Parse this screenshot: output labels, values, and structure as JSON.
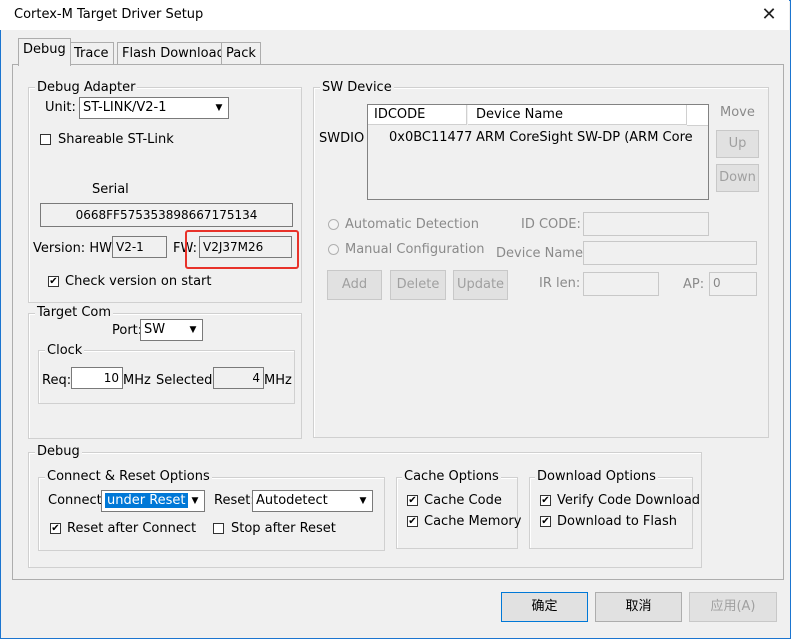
{
  "window": {
    "title": "Cortex-M Target Driver Setup",
    "close_label": "✕"
  },
  "tabs": [
    "Debug",
    "Trace",
    "Flash Download",
    "Pack"
  ],
  "debug_adapter": {
    "group_label": "Debug Adapter",
    "unit_label": "Unit:",
    "unit_value": "ST-LINK/V2-1",
    "shareable_label": "Shareable ST-Link",
    "serial_label": "Serial",
    "serial_value": "0668FF575353898667175134",
    "version_hw_label": "Version: HW:",
    "hw_value": "V2-1",
    "fw_label": "FW:",
    "fw_value": "V2J37M26",
    "check_version_label": "Check version on start"
  },
  "target_com": {
    "group_label": "Target Com",
    "port_label": "Port:",
    "port_value": "SW",
    "clock_label": "Clock",
    "req_label": "Req:",
    "req_value": "10",
    "req_unit": "MHz",
    "selected_label": "Selected:",
    "selected_value": "4",
    "selected_unit": "MHz"
  },
  "sw_device": {
    "group_label": "SW Device",
    "move_label": "Move",
    "up_label": "Up",
    "down_label": "Down",
    "col_idcode": "IDCODE",
    "col_device_name": "Device Name",
    "row_label": "SWDIO",
    "row_idcode": "0x0BC11477",
    "row_device": "ARM CoreSight SW-DP (ARM Core",
    "auto_detect_label": "Automatic Detection",
    "manual_config_label": "Manual Configuration",
    "id_code_label": "ID CODE:",
    "device_name_label": "Device Name:",
    "add_label": "Add",
    "delete_label": "Delete",
    "update_label": "Update",
    "ir_len_label": "IR len:",
    "ap_label": "AP:",
    "ap_value": "0"
  },
  "debug": {
    "group_label": "Debug",
    "connect_reset_label": "Connect & Reset Options",
    "connect_label": "Connect:",
    "connect_value": "under Reset",
    "reset_label": "Reset:",
    "reset_value": "Autodetect",
    "reset_after_connect_label": "Reset after Connect",
    "stop_after_reset_label": "Stop after Reset",
    "cache_options_label": "Cache Options",
    "cache_code_label": "Cache Code",
    "cache_memory_label": "Cache Memory",
    "download_options_label": "Download Options",
    "verify_code_label": "Verify Code Download",
    "download_flash_label": "Download to Flash"
  },
  "buttons": {
    "ok_label": "确定",
    "cancel_label": "取消",
    "apply_label": "应用(A)"
  },
  "checks": {
    "shareable": false,
    "check_version": true,
    "reset_after_connect": true,
    "stop_after_reset": false,
    "cache_code": true,
    "cache_memory": true,
    "verify_code": true,
    "download_flash": true
  },
  "colors": {
    "highlight_box": "#e8322a",
    "selection": "#0078d7",
    "window_border": "#1b75d0"
  }
}
